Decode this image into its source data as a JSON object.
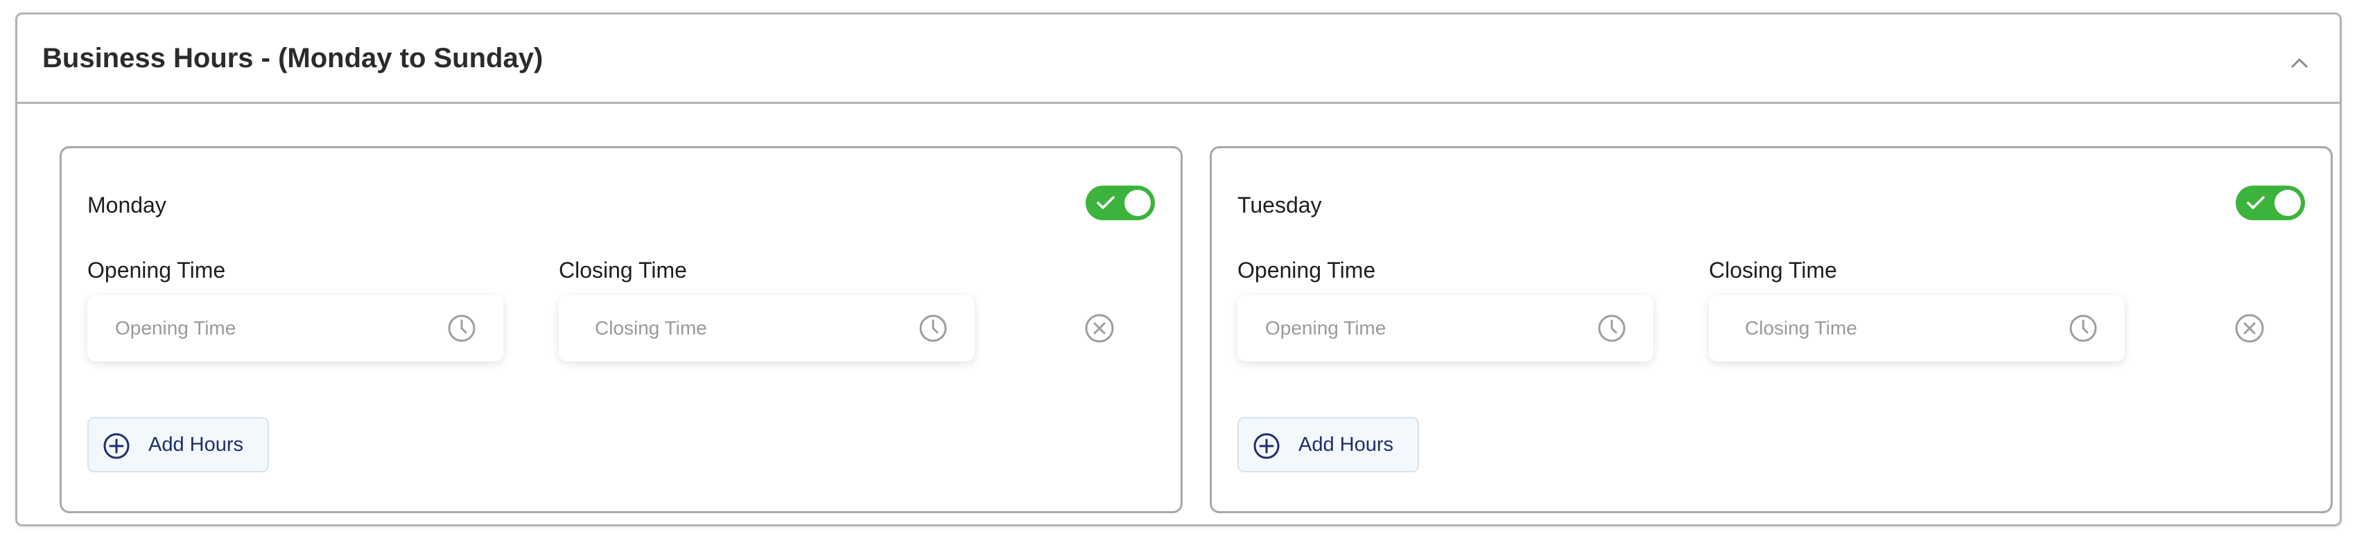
{
  "section": {
    "title": "Business Hours - (Monday to Sunday)",
    "collapse_icon": "chevron-up-icon"
  },
  "days": [
    {
      "name": "Monday",
      "enabled": true,
      "opening_label": "Opening Time",
      "closing_label": "Closing Time",
      "opening_placeholder": "Opening Time",
      "closing_placeholder": "Closing Time",
      "add_hours_label": "Add Hours"
    },
    {
      "name": "Tuesday",
      "enabled": true,
      "opening_label": "Opening Time",
      "closing_label": "Closing Time",
      "opening_placeholder": "Opening Time",
      "closing_placeholder": "Closing Time",
      "add_hours_label": "Add Hours"
    }
  ],
  "colors": {
    "toggle_on": "#3cb33c",
    "accent_text": "#1f2d6b",
    "placeholder": "#9a9a9a",
    "icon_gray": "#9e9e9e",
    "border": "#b3b3b3"
  }
}
